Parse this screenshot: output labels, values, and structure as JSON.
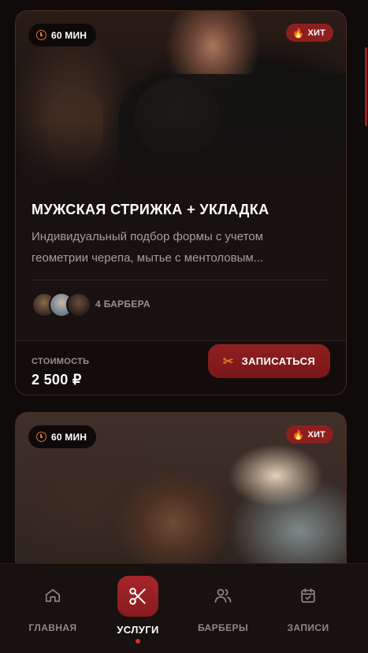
{
  "cards": [
    {
      "duration": "60 МИН",
      "tag": "ХИТ",
      "title": "МУЖСКАЯ СТРИЖКА + УКЛАДКА",
      "description": "Индивидуальный подбор формы с учетом геометрии черепа, мытье с ментоловым...",
      "barbers_count": "4 БАРБЕРА",
      "price_label": "СТОИМОСТЬ",
      "price": "2 500 ₽",
      "book_label": "ЗАПИСАТЬСЯ"
    },
    {
      "duration": "60 МИН",
      "tag": "ХИТ"
    }
  ],
  "nav": [
    {
      "label": "ГЛАВНАЯ",
      "icon": "home-icon",
      "active": false
    },
    {
      "label": "УСЛУГИ",
      "icon": "scissors-icon",
      "active": true
    },
    {
      "label": "БАРБЕРЫ",
      "icon": "users-icon",
      "active": false
    },
    {
      "label": "ЗАПИСИ",
      "icon": "calendar-check-icon",
      "active": false
    }
  ],
  "colors": {
    "accent": "#8e1f1f",
    "accent_orange": "#e0762a",
    "background": "#0f0b0a",
    "card": "#171110",
    "card_border": "#4a2c1f"
  }
}
